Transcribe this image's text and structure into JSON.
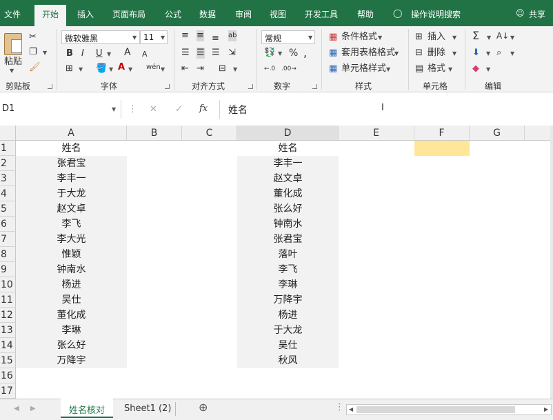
{
  "tabs": [
    "文件",
    "开始",
    "插入",
    "页面布局",
    "公式",
    "数据",
    "审阅",
    "视图",
    "开发工具",
    "帮助",
    "操作说明搜索",
    "共享"
  ],
  "ribbon": {
    "clipboard": {
      "paste": "粘贴",
      "label": "剪贴板"
    },
    "font": {
      "name": "微软雅黑",
      "size": "11",
      "bold": "B",
      "italic": "I",
      "underline": "U",
      "grow": "A",
      "shrink": "A",
      "label": "字体"
    },
    "align": {
      "label": "对齐方式"
    },
    "number": {
      "format": "常规",
      "label": "数字"
    },
    "styles": {
      "cond": "条件格式",
      "table": "套用表格格式",
      "cell": "单元格样式",
      "label": "样式"
    },
    "cells": {
      "insert": "插入",
      "delete": "删除",
      "format": "格式",
      "label": "单元格"
    },
    "editing": {
      "label": "编辑"
    }
  },
  "formula_bar": {
    "name_box": "D1",
    "fx": "fx",
    "content": "姓名"
  },
  "columns": [
    "A",
    "B",
    "C",
    "D",
    "E",
    "F",
    "G"
  ],
  "rows": [
    "1",
    "2",
    "3",
    "4",
    "5",
    "6",
    "7",
    "8",
    "9",
    "10",
    "11",
    "12",
    "13",
    "14",
    "15",
    "16",
    "17"
  ],
  "col_a": [
    "姓名",
    "张君宝",
    "李丰一",
    "于大龙",
    "赵文卓",
    "李飞",
    "李大光",
    "惟颖",
    "钟南水",
    "杨进",
    "吴仕",
    "董化成",
    "李琳",
    "张么好",
    "万降宇"
  ],
  "col_d": [
    "姓名",
    "李丰一",
    "赵文卓",
    "董化成",
    "张么好",
    "钟南水",
    "张君宝",
    "落叶",
    "李飞",
    "李琳",
    "万降宇",
    "杨进",
    "于大龙",
    "吴仕",
    "秋风"
  ],
  "sheets": [
    "姓名核对",
    "Sheet1 (2)"
  ],
  "colors": {
    "brand": "#217346",
    "highlight": "#ffe699",
    "shade": "#f2f2f2"
  }
}
